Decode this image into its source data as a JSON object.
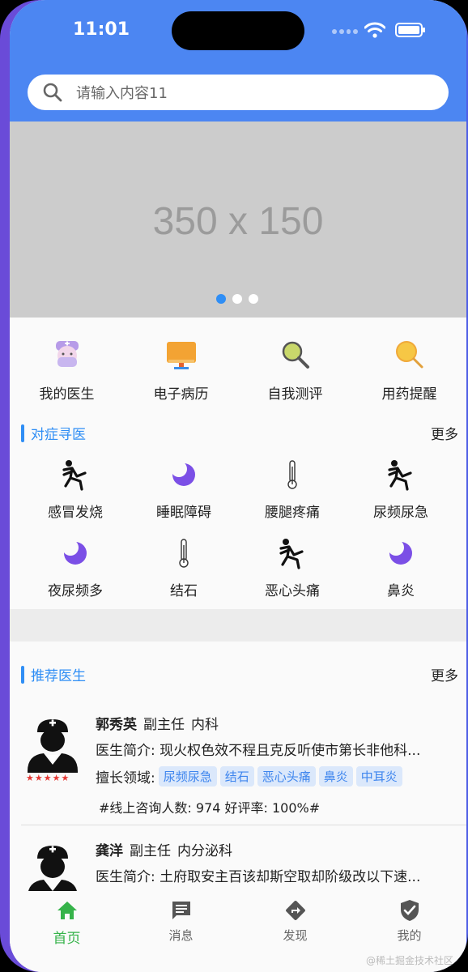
{
  "status": {
    "time": "11:01"
  },
  "search": {
    "placeholder": "请输入内容11"
  },
  "banner": {
    "text": "350 x 150",
    "active_dot": 0,
    "dot_count": 3
  },
  "quick_nav": [
    {
      "label": "我的医生",
      "icon": "doctor-icon"
    },
    {
      "label": "电子病历",
      "icon": "monitor-icon"
    },
    {
      "label": "自我测评",
      "icon": "magnifier-icon"
    },
    {
      "label": "用药提醒",
      "icon": "magnifier-yellow-icon"
    }
  ],
  "symptoms": {
    "title": "对症寻医",
    "more": "更多",
    "items": [
      {
        "label": "感冒发烧",
        "icon": "running-figure-icon"
      },
      {
        "label": "睡眠障碍",
        "icon": "moon-icon"
      },
      {
        "label": "腰腿疼痛",
        "icon": "thermometer-icon"
      },
      {
        "label": "尿频尿急",
        "icon": "running-figure-icon"
      },
      {
        "label": "夜尿频多",
        "icon": "moon-icon"
      },
      {
        "label": "结石",
        "icon": "thermometer-icon"
      },
      {
        "label": "恶心头痛",
        "icon": "running-figure-icon"
      },
      {
        "label": "鼻炎",
        "icon": "moon-icon"
      }
    ]
  },
  "doctors": {
    "title": "推荐医生",
    "more": "更多",
    "list": [
      {
        "name": "郭秀英",
        "title": "副主任",
        "dept": "内科",
        "intro": "医生简介: 现火权色效不程且克反听使市第长非他科...",
        "skill_label": "擅长领域:",
        "tags": [
          "尿频尿急",
          "结石",
          "恶心头痛",
          "鼻炎",
          "中耳炎"
        ],
        "stats": "#线上咨询人数:   974  好评率:   100%#",
        "stars": "★★★★★"
      },
      {
        "name": "龚洋",
        "title": "副主任",
        "dept": "内分泌科",
        "intro": "医生简介: 土府取安主百该却斯空取却阶级改以下速...",
        "stars": "★★★★★"
      }
    ]
  },
  "tabbar": [
    {
      "label": "首页",
      "icon": "home-icon",
      "active": true
    },
    {
      "label": "消息",
      "icon": "message-icon",
      "active": false
    },
    {
      "label": "发现",
      "icon": "discover-icon",
      "active": false
    },
    {
      "label": "我的",
      "icon": "shield-icon",
      "active": false
    }
  ],
  "watermark": "@稀土掘金技术社区",
  "colors": {
    "header": "#4c86f2",
    "accent": "#2f8ef5",
    "tab_active": "#36b34a",
    "tag_bg": "#dbe8fb"
  }
}
